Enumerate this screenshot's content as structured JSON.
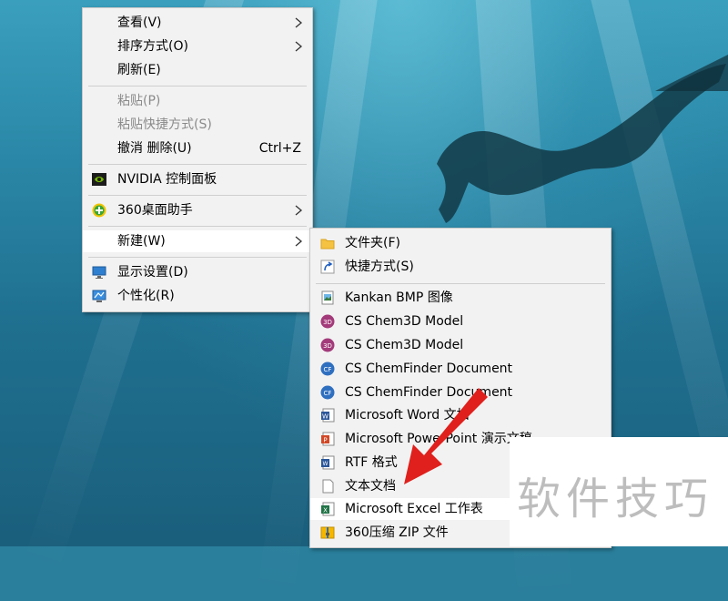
{
  "context_menu": {
    "items": [
      {
        "label": "查看(V)"
      },
      {
        "label": "排序方式(O)"
      },
      {
        "label": "刷新(E)"
      },
      {
        "label": "粘贴(P)"
      },
      {
        "label": "粘贴快捷方式(S)"
      },
      {
        "label": "撤消 删除(U)",
        "shortcut": "Ctrl+Z"
      },
      {
        "label": "NVIDIA 控制面板",
        "icon": "nvidia-icon"
      },
      {
        "label": "360桌面助手",
        "icon": "360-icon"
      },
      {
        "label": "新建(W)"
      },
      {
        "label": "显示设置(D)",
        "icon": "display-settings-icon"
      },
      {
        "label": "个性化(R)",
        "icon": "personalize-icon"
      }
    ]
  },
  "new_submenu": {
    "items": [
      {
        "label": "文件夹(F)",
        "icon": "folder-icon"
      },
      {
        "label": "快捷方式(S)",
        "icon": "shortcut-icon"
      },
      {
        "label": "Kankan BMP 图像",
        "icon": "bmp-image-icon"
      },
      {
        "label": "CS Chem3D Model",
        "icon": "chem3d-icon"
      },
      {
        "label": "CS Chem3D Model",
        "icon": "chem3d-icon"
      },
      {
        "label": "CS ChemFinder Document",
        "icon": "chemfinder-icon"
      },
      {
        "label": "CS ChemFinder Document",
        "icon": "chemfinder-icon"
      },
      {
        "label": "Microsoft Word 文档",
        "icon": "word-icon"
      },
      {
        "label": "Microsoft PowerPoint 演示文稿",
        "icon": "powerpoint-icon"
      },
      {
        "label": "RTF 格式",
        "icon": "rtf-icon"
      },
      {
        "label": "文本文档",
        "icon": "text-document-icon"
      },
      {
        "label": "Microsoft Excel 工作表",
        "icon": "excel-icon"
      },
      {
        "label": "360压缩 ZIP 文件",
        "icon": "zip-icon"
      }
    ]
  },
  "watermark": {
    "text": "软件技巧"
  },
  "colors": {
    "arrow": "#e0201c",
    "menu_bg": "#f2f2f2",
    "highlight": "#ffffff"
  }
}
